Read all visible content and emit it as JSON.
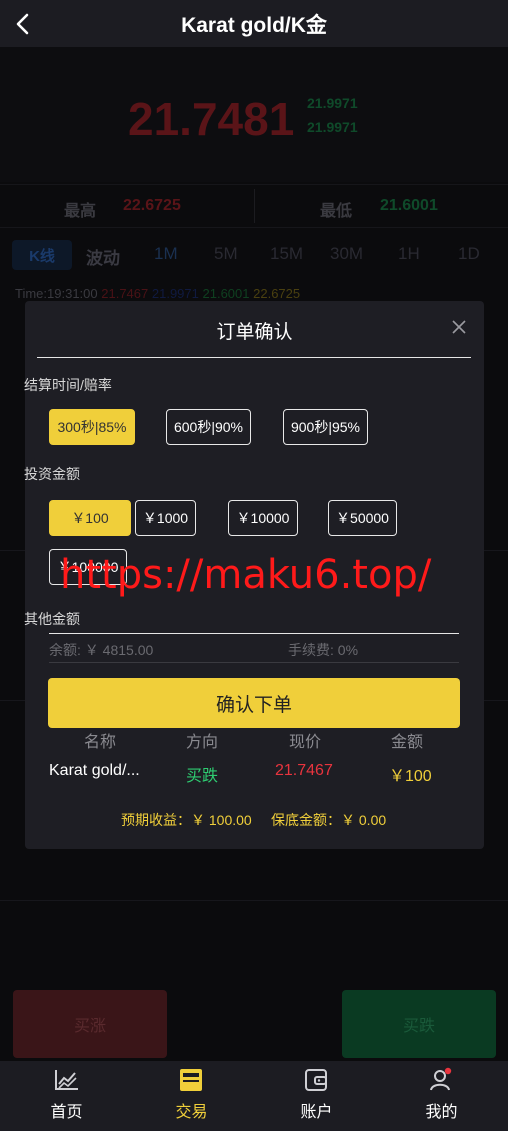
{
  "header": {
    "title": "Karat gold/K金"
  },
  "ticker": {
    "price": "21.7481",
    "side_top": "21.9971",
    "side_bottom": "21.9971"
  },
  "stats": {
    "high_label": "最高",
    "high_value": "22.6725",
    "low_label": "最低",
    "low_value": "21.6001"
  },
  "tabs": [
    "K线",
    "波动",
    "1M",
    "5M",
    "15M",
    "30M",
    "1H",
    "1D"
  ],
  "timebar": {
    "time": "Time:19:31:00",
    "v1": "21.7467",
    "v2": "21.9971",
    "v3": "21.6001",
    "v4": "22.6725"
  },
  "modal": {
    "title": "订单确认",
    "settle_label": "结算时间/赔率",
    "settle_options": [
      "300秒|85%",
      "600秒|90%",
      "900秒|95%"
    ],
    "amount_label": "投资金额",
    "amount_options": [
      "￥100",
      "￥1000",
      "￥10000",
      "￥50000",
      "￥100000"
    ],
    "other_label": "其他金额",
    "balance": "余额: ￥ 4815.00",
    "fee": "手续费: 0%",
    "confirm_label": "确认下单",
    "table_headers": [
      "名称",
      "方向",
      "现价",
      "金额"
    ],
    "table_row": [
      "Karat gold/...",
      "买跌",
      "21.7467",
      "￥100"
    ],
    "expected_label": "预期收益：￥ 100.00",
    "guarantee_label": "保底金额：￥ 0.00"
  },
  "watermark": "https://maku6.top/",
  "actions": {
    "buy_up": "买涨",
    "buy_down": "买跌"
  },
  "nav": [
    "首页",
    "交易",
    "账户",
    "我的"
  ],
  "colors": {
    "accent": "#f0cf3a",
    "up_red": "#e8343e",
    "down_green": "#2ecc71"
  }
}
